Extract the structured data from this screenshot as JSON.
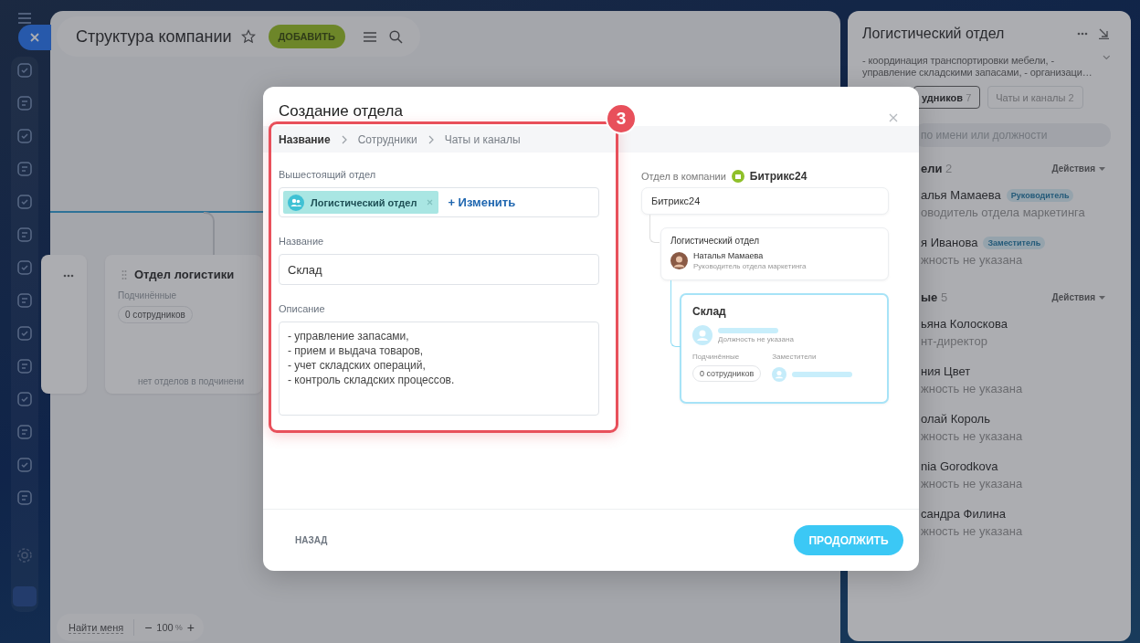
{
  "header": {
    "title": "Структура компании",
    "add_button": "ДОБАВИТЬ"
  },
  "canvas": {
    "cards": [
      {
        "title": "Отдел логистики",
        "subordinates_label": "Подчинённые",
        "subordinates": "0 сотрудников",
        "empty_note": "нет отделов в подчинени"
      }
    ]
  },
  "zoom_bar": {
    "find_me": "Найти меня",
    "zoom_out": "−",
    "zoom": "100",
    "unit": "%",
    "zoom_in": "+"
  },
  "right_panel": {
    "title": "Логистический отдел",
    "description": "- координация транспортировки мебели, - управление складскими запасами, - организаци…",
    "tabs": [
      {
        "label": "удников",
        "count": "7",
        "selected": true
      },
      {
        "label": "Чаты и каналы",
        "count": "2",
        "selected": false
      }
    ],
    "search": {
      "placeholder": "по имени или должности"
    },
    "groups": [
      {
        "title": "ели",
        "count": "2",
        "actions": "Действия",
        "members": [
          {
            "name": "алья Мамаева",
            "role": "оводитель отдела маркетинга",
            "badge": "Руководитель"
          },
          {
            "name": "я Иванова",
            "role": "жность не указана",
            "badge": "Заместитель"
          }
        ]
      },
      {
        "title": "ые",
        "count": "5",
        "actions": "Действия",
        "members": [
          {
            "name": "ьяна Колоскова",
            "role": "нт-директор"
          },
          {
            "name": "ния Цвет",
            "role": "жность не указана"
          },
          {
            "name": "олай Король",
            "role": "жность не указана"
          },
          {
            "name": "nia Gorodkova",
            "role": "жность не указана"
          },
          {
            "name": "сандра Филина",
            "role": "жность не указана"
          }
        ]
      }
    ]
  },
  "modal": {
    "title": "Создание отдела",
    "steps": [
      {
        "label": "Название",
        "selected": true
      },
      {
        "label": "Сотрудники",
        "selected": false
      },
      {
        "label": "Чаты и каналы",
        "selected": false
      }
    ],
    "parent_label": "Вышестоящий отдел",
    "parent_chip": "Логистический отдел",
    "change_link": "+ Изменить",
    "name_label": "Название",
    "name_value": "Склад",
    "description_label": "Описание",
    "description_value": "- управление запасами,\n- прием и выдача товаров,\n- учет складских операций,\n- контроль складских процессов.",
    "preview": {
      "company_label": "Отдел в компании",
      "company": "Битрикс24",
      "root": "Битрикс24",
      "parent": {
        "title": "Логистический отдел",
        "head_name": "Наталья Мамаева",
        "head_role": "Руководитель отдела маркетинга"
      },
      "new": {
        "title": "Склад",
        "head_role": "Должность не указана",
        "subordinates_label": "Подчинённые",
        "subordinates": "0 сотрудников",
        "deputies_label": "Заместители"
      }
    },
    "back_button": "НАЗАД",
    "continue_button": "ПРОДОЛЖИТЬ"
  },
  "annotation": {
    "badge": "3"
  }
}
